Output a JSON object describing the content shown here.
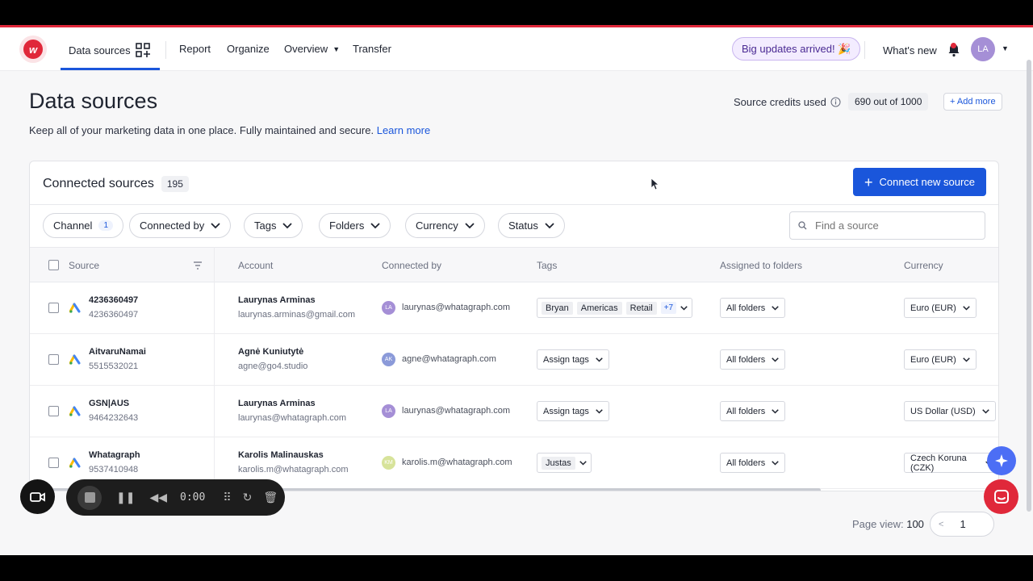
{
  "nav": {
    "items": [
      {
        "label": "Data sources"
      },
      {
        "label": "Report"
      },
      {
        "label": "Organize"
      },
      {
        "label": "Overview"
      },
      {
        "label": "Transfer"
      }
    ],
    "updates_badge": "Big updates arrived! 🎉",
    "whats_new": "What's new",
    "avatar_initials": "LA"
  },
  "header": {
    "title": "Data sources",
    "subtitle": "Keep all of your marketing data in one place. Fully maintained and secure.",
    "learn_more": "Learn more",
    "credits_label": "Source credits used",
    "credits_value": "690 out of 1000",
    "add_more": "+ Add more"
  },
  "card": {
    "title": "Connected sources",
    "count": "195",
    "connect_button": "Connect new source",
    "filters": [
      {
        "label": "Channel",
        "count": "1"
      },
      {
        "label": "Connected by"
      },
      {
        "label": "Tags"
      },
      {
        "label": "Folders"
      },
      {
        "label": "Currency"
      },
      {
        "label": "Status"
      }
    ],
    "search_placeholder": "Find a source",
    "columns": [
      "Source",
      "Account",
      "Connected by",
      "Tags",
      "Assigned to folders",
      "Currency"
    ],
    "rows": [
      {
        "source": "4236360497",
        "source_id": "4236360497",
        "account": "Laurynas Arminas",
        "account_email": "laurynas.arminas@gmail.com",
        "avatar": "LA",
        "connected_by": "laurynas@whatagraph.com",
        "tags": [
          "Bryan",
          "Americas",
          "Retail"
        ],
        "tags_more": "+7",
        "folders": "All folders",
        "currency": "Euro (EUR)"
      },
      {
        "source": "AitvaruNamai",
        "source_id": "5515532021",
        "account": "Agnė Kuniutytė",
        "account_email": "agne@go4.studio",
        "avatar": "AK",
        "connected_by": "agne@whatagraph.com",
        "tags_label": "Assign tags",
        "folders": "All folders",
        "currency": "Euro (EUR)"
      },
      {
        "source": "GSN|AUS",
        "source_id": "9464232643",
        "account": "Laurynas Arminas",
        "account_email": "laurynas@whatagraph.com",
        "avatar": "LA",
        "connected_by": "laurynas@whatagraph.com",
        "tags_label": "Assign tags",
        "folders": "All folders",
        "currency": "US Dollar (USD)"
      },
      {
        "source": "Whatagraph",
        "source_id": "9537410948",
        "account": "Karolis Malinauskas",
        "account_email": "karolis.m@whatagraph.com",
        "avatar": "KM",
        "connected_by": "karolis.m@whatagraph.com",
        "tags": [
          "Justas"
        ],
        "folders": "All folders",
        "currency": "Czech Koruna (CZK)"
      }
    ]
  },
  "pager": {
    "label": "Page view:",
    "size": "100",
    "page": "1"
  },
  "recorder": {
    "time": "0:00"
  },
  "colors": {
    "accent": "#1a56db",
    "brand": "#e0283a"
  }
}
